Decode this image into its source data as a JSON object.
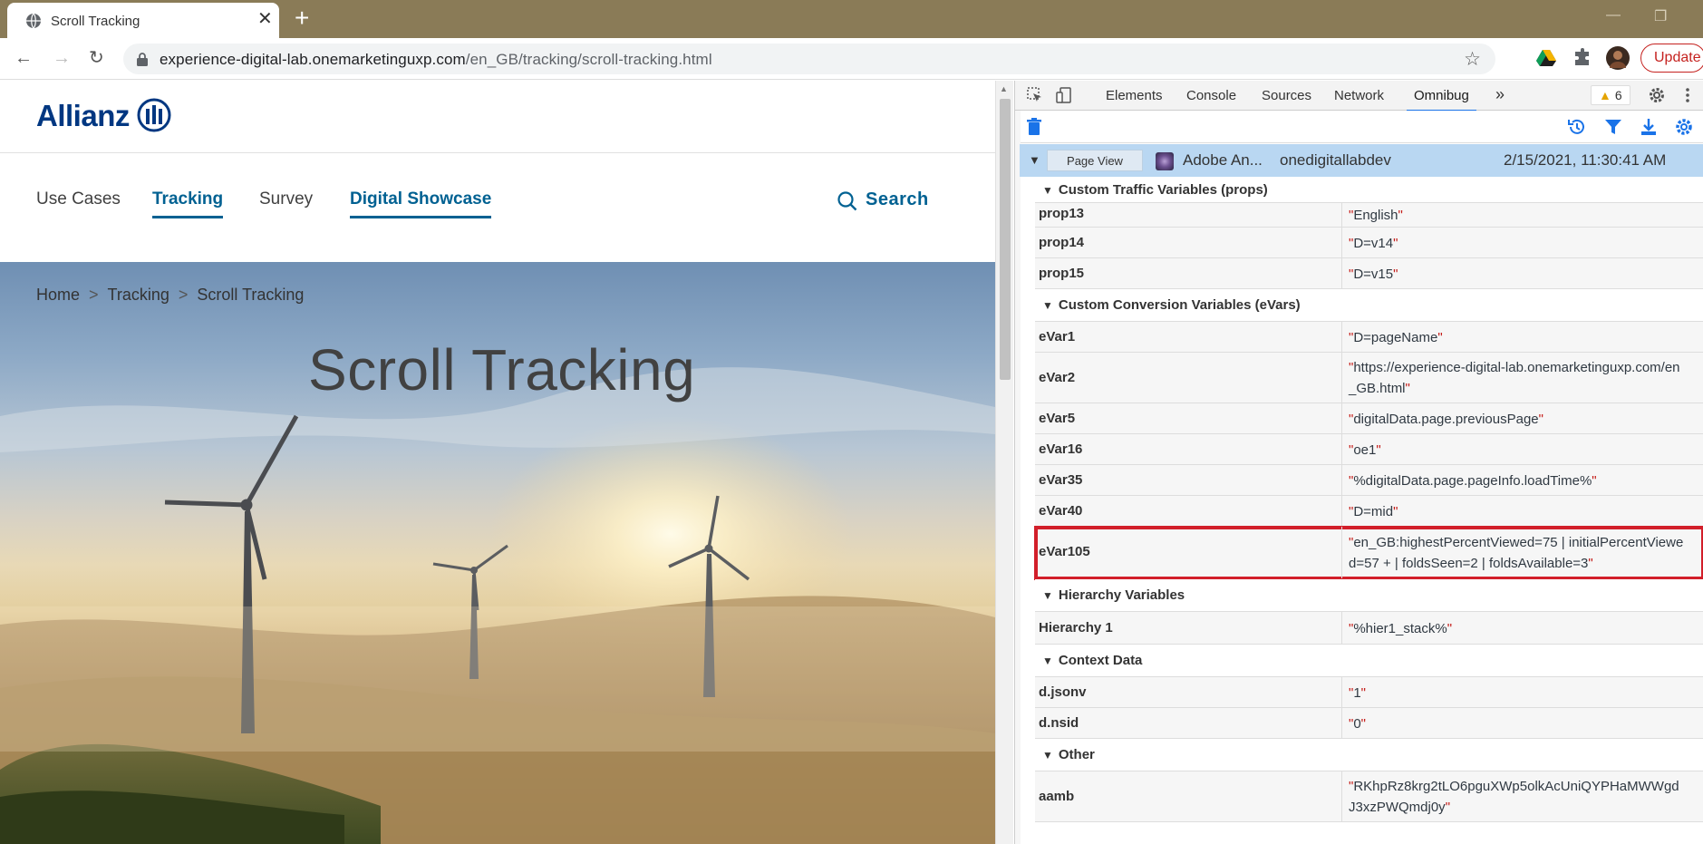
{
  "tab": {
    "title": "Scroll Tracking",
    "close": "✕",
    "new_tab": "+"
  },
  "window": {
    "minimize": "—",
    "restore": "❐"
  },
  "address_bar": {
    "domain": "experience-digital-lab.onemarketinguxp.com",
    "path": "/en_GB/tracking/scroll-tracking.html"
  },
  "update_label": "Update",
  "site": {
    "logo_text": "Allianz",
    "nav": {
      "use_cases": "Use Cases",
      "tracking": "Tracking",
      "survey": "Survey",
      "digital_showcase": "Digital Showcase"
    },
    "search_label": "Search",
    "breadcrumb": {
      "home": "Home",
      "tracking": "Tracking",
      "current": "Scroll Tracking"
    },
    "hero_title": "Scroll Tracking"
  },
  "devtools": {
    "tabs": {
      "elements": "Elements",
      "console": "Console",
      "sources": "Sources",
      "network": "Network",
      "omnibug": "Omnibug"
    },
    "more_tabs": "»",
    "warning_count": "6",
    "request": {
      "type_badge": "Page View",
      "provider": "Adobe An...",
      "account": "onedigitallabdev",
      "timestamp": "2/15/2021, 11:30:41 AM"
    },
    "sections": {
      "props": "Custom Traffic Variables (props)",
      "evars": "Custom Conversion Variables (eVars)",
      "hierarchy": "Hierarchy Variables",
      "context": "Context Data",
      "other": "Other"
    },
    "props": [
      {
        "key": "prop13",
        "value": "English"
      },
      {
        "key": "prop14",
        "value": "D=v14"
      },
      {
        "key": "prop15",
        "value": "D=v15"
      }
    ],
    "evars": [
      {
        "key": "eVar1",
        "value": "D=pageName"
      },
      {
        "key": "eVar2",
        "value": "https://experience-digital-lab.onemarketinguxp.com/en_GB.html"
      },
      {
        "key": "eVar5",
        "value": "digitalData.page.previousPage"
      },
      {
        "key": "eVar16",
        "value": "oe1"
      },
      {
        "key": "eVar35",
        "value": "%digitalData.page.pageInfo.loadTime%"
      },
      {
        "key": "eVar40",
        "value": "D=mid"
      },
      {
        "key": "eVar105",
        "value": "en_GB:highestPercentViewed=75 | initialPercentViewed=57 + | foldsSeen=2 | foldsAvailable=3"
      }
    ],
    "hierarchy": [
      {
        "key": "Hierarchy 1",
        "value": "%hier1_stack%"
      }
    ],
    "context": [
      {
        "key": "d.jsonv",
        "value": "1"
      },
      {
        "key": "d.nsid",
        "value": "0"
      }
    ],
    "other": [
      {
        "key": "aamb",
        "value": "RKhpRz8krg2tLO6pguXWp5olkAcUniQYPHaMWWgdJ3xzPWQmdj0y"
      }
    ]
  },
  "colors": {
    "tab_strip": "#8a7b57",
    "brand_blue": "#003781",
    "link_blue": "#006192",
    "highlight_red": "#d21f2a",
    "selected_row": "#b9d7f2"
  }
}
